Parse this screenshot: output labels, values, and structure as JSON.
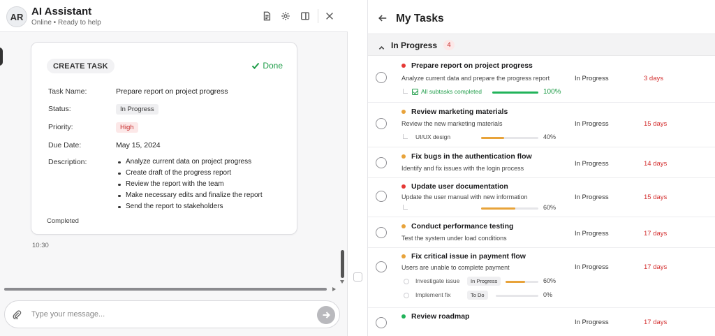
{
  "colors": {
    "accent_green": "#1f9d49",
    "danger_red": "#d32f2f",
    "orange": "#e8a33a",
    "red_dot": "#e53935",
    "green_dot": "#22b35a"
  },
  "assistant": {
    "avatar_initials": "AR",
    "title": "AI Assistant",
    "status": "Online • Ready to help",
    "header_icons": [
      "document-icon",
      "gear-icon",
      "split-panel-icon",
      "close-icon"
    ]
  },
  "task_card": {
    "badge": "CREATE TASK",
    "done_label": "Done",
    "labels": {
      "name": "Task Name:",
      "status": "Status:",
      "priority": "Priority:",
      "due": "Due Date:",
      "description": "Description:"
    },
    "values": {
      "name": "Prepare report on project progress",
      "status": "In Progress",
      "priority": "High",
      "due": "May 15, 2024"
    },
    "description": [
      "Analyze current data on project progress",
      "Create draft of the progress report",
      "Review the report with the team",
      "Make necessary edits and finalize the report",
      "Send the report to stakeholders"
    ],
    "footer": "Completed"
  },
  "message_time": "10:30",
  "composer": {
    "placeholder": "Type your message..."
  },
  "tasks_panel": {
    "title": "My Tasks",
    "group": {
      "label": "In Progress",
      "count": "4"
    },
    "tasks": [
      {
        "title": "Prepare report on project progress",
        "dot": "#e53935",
        "desc": "Analyze current data and prepare the progress report",
        "status": "In Progress",
        "due": "3 days",
        "subtasks": [
          {
            "label": "All subtasks completed",
            "done": true,
            "progress": 100,
            "pct": "100%"
          }
        ]
      },
      {
        "title": "Review marketing materials",
        "dot": "#e8a33a",
        "desc": "Review the new marketing materials",
        "status": "In Progress",
        "due": "15 days",
        "subtasks": [
          {
            "label": "UI/UX design",
            "progress": 40,
            "pct": "40%"
          }
        ]
      },
      {
        "title": "Fix bugs in the authentication flow",
        "dot": "#e8a33a",
        "desc": "Identify and fix issues with the login process",
        "status": "In Progress",
        "due": "14 days"
      },
      {
        "title": "Update user documentation",
        "dot": "#e53935",
        "desc": "Update the user manual with new information",
        "status": "In Progress",
        "due": "15 days",
        "subtasks": [
          {
            "label": "",
            "progress": 60,
            "pct": "60%"
          }
        ]
      },
      {
        "title": "Conduct performance testing",
        "dot": "#e8a33a",
        "desc": "Test the system under load conditions",
        "status": "In Progress",
        "due": "17 days"
      },
      {
        "title": "Fix critical issue in payment flow",
        "dot": "#e8a33a",
        "desc": "Users are unable to complete payment",
        "status": "In Progress",
        "due": "17 days",
        "subtasks": [
          {
            "label": "Investigate issue",
            "tag": "In Progress",
            "progress": 60,
            "pct": "60%"
          },
          {
            "label": "Implement fix",
            "tag": "To Do",
            "progress": 0,
            "pct": "0%"
          }
        ]
      },
      {
        "title": "Review roadmap",
        "dot": "#22b35a",
        "desc": "",
        "status": "In Progress",
        "due": "17 days"
      }
    ]
  }
}
